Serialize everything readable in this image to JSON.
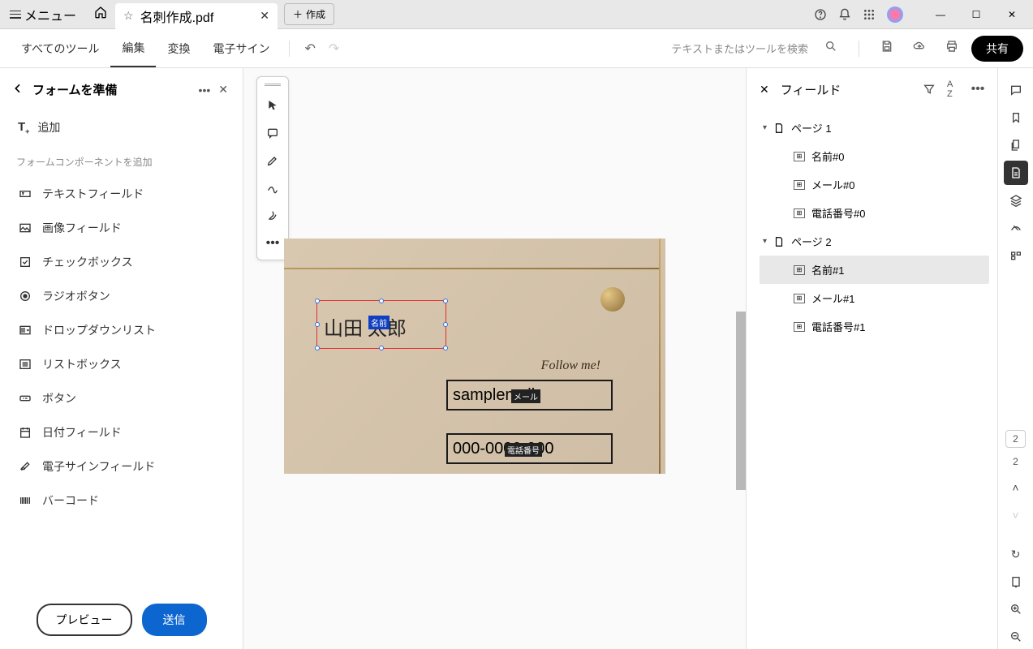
{
  "titlebar": {
    "menu_label": "メニュー",
    "tab_title": "名刺作成.pdf",
    "new_tab_label": "作成"
  },
  "toolbar": {
    "tabs": [
      "すべてのツール",
      "編集",
      "変換",
      "電子サイン"
    ],
    "active_tab": 1,
    "search_placeholder": "テキストまたはツールを検索",
    "share_label": "共有"
  },
  "left_panel": {
    "title": "フォームを準備",
    "add_label": "追加",
    "section_label": "フォームコンポーネントを追加",
    "items": [
      "テキストフィールド",
      "画像フィールド",
      "チェックボックス",
      "ラジオボタン",
      "ドロップダウンリスト",
      "リストボックス",
      "ボタン",
      "日付フィールド",
      "電子サインフィールド",
      "バーコード"
    ],
    "preview_label": "プレビュー",
    "send_label": "送信"
  },
  "canvas": {
    "followme_text": "Follow me!",
    "name_field_text": "山田 太郎",
    "name_field_tag": "名前",
    "email_field_text": "samplemail",
    "email_field_tag": "メール",
    "phone_field_text": "000-0000-000",
    "phone_field_tag": "電話番号"
  },
  "right_panel": {
    "title": "フィールド",
    "pages": [
      {
        "label": "ページ 1",
        "fields": [
          "名前#0",
          "メール#0",
          "電話番号#0"
        ]
      },
      {
        "label": "ページ 2",
        "fields": [
          "名前#1",
          "メール#1",
          "電話番号#1"
        ]
      }
    ],
    "selected_field": "名前#1"
  },
  "rail": {
    "current_page_input": "2",
    "total_pages": "2"
  }
}
